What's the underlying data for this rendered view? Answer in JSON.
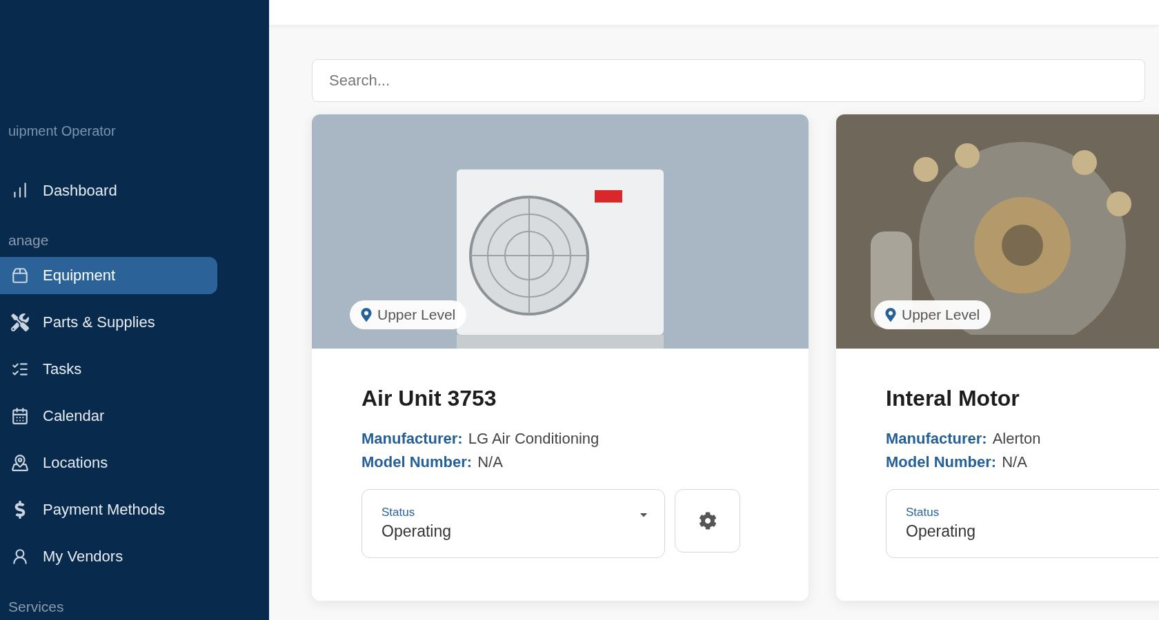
{
  "sidebar": {
    "subtitle": "uipment Operator",
    "items": [
      {
        "kind": "chart",
        "label": "Dashboard",
        "selected": false
      }
    ],
    "sections": [
      {
        "heading": "anage",
        "items": [
          {
            "kind": "box",
            "label": "Equipment",
            "selected": true
          },
          {
            "kind": "tools",
            "label": "Parts & Supplies",
            "selected": false
          },
          {
            "kind": "checklist",
            "label": "Tasks",
            "selected": false
          },
          {
            "kind": "calendar",
            "label": "Calendar",
            "selected": false
          },
          {
            "kind": "map",
            "label": "Locations",
            "selected": false
          },
          {
            "kind": "dollar",
            "label": "Payment Methods",
            "selected": false
          },
          {
            "kind": "person",
            "label": "My Vendors",
            "selected": false
          }
        ]
      },
      {
        "heading": "Services"
      }
    ]
  },
  "search": {
    "placeholder": "Search..."
  },
  "cards": [
    {
      "kind": "air-conditioner",
      "location": "Upper Level",
      "title": "Air Unit 3753",
      "fields": [
        {
          "label": "Manufacturer:",
          "value": "LG Air Conditioning"
        },
        {
          "label": "Model Number:",
          "value": "N/A"
        }
      ],
      "status": {
        "label": "Status",
        "value": "Operating"
      },
      "settings_button": true
    },
    {
      "kind": "engine",
      "location": "Upper Level",
      "title": "Interal Motor",
      "fields": [
        {
          "label": "Manufacturer:",
          "value": "Alerton"
        },
        {
          "label": "Model Number:",
          "value": "N/A"
        }
      ],
      "status": {
        "label": "Status",
        "value": "Operating"
      }
    }
  ]
}
